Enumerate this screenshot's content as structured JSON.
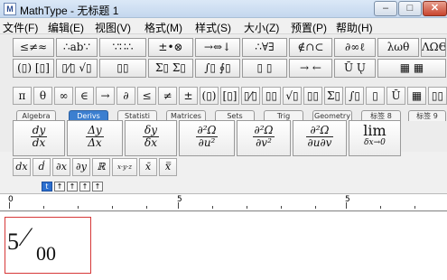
{
  "window": {
    "title": "MathType - 无标题 1",
    "app_icon": "mathtype-icon",
    "min": "–",
    "max": "□",
    "close": "✕"
  },
  "menu": [
    "文件(F)",
    "编辑(E)",
    "视图(V)",
    "格式(M)",
    "样式(S)",
    "大小(Z)",
    "预置(P)",
    "帮助(H)"
  ],
  "toolbar_row1": [
    "≤≠≈",
    "∴ab∵",
    "∵∷∴",
    "±•⊗",
    "→⇔↓",
    "∴∀∃",
    "∉∩⊂",
    "∂∞ℓ",
    "λωθ",
    "ΛΩΘ"
  ],
  "toolbar_row2": [
    "(▯) [▯]",
    "▯⁄▯ √▯",
    "▯▯",
    "Σ▯ Σ▯",
    "∫▯ ∮▯",
    "▯ ▯",
    "→ ←",
    "Ū Ų",
    "▦ ▦"
  ],
  "toolbar_row3": [
    "π",
    "θ",
    "∞",
    "∈",
    "→",
    "∂",
    "≤",
    "≠",
    "±",
    "(▯)",
    "[▯]",
    "▯⁄▯",
    "▯▯",
    "√▯",
    "▯▯",
    "Σ▯",
    "∫▯",
    "▯",
    "Ū",
    "▦",
    "▯▯",
    "▯▯",
    "▯▯"
  ],
  "tabs": [
    "Algebra",
    "Derivs",
    "Statisti",
    "Matrices",
    "Sets",
    "Trig",
    "Geometry",
    "标签 8",
    "标签 9"
  ],
  "active_tab": "Derivs",
  "deriv_templates": [
    {
      "num": "dy",
      "den": "dx"
    },
    {
      "num": "Δy",
      "den": "Δx"
    },
    {
      "num": "δy",
      "den": "δx"
    },
    {
      "num": "∂²Ω",
      "den": "∂u²"
    },
    {
      "num": "∂²Ω",
      "den": "∂v²"
    },
    {
      "num": "∂²Ω",
      "den": "∂u∂v"
    }
  ],
  "lim_template": {
    "top": "lim",
    "bottom": "δx→0"
  },
  "small_templates": [
    "dx",
    "ḋ",
    "∂x",
    "∂y",
    "ℝ",
    "x·y·z",
    "x̄",
    "x̿"
  ],
  "size_buttons": [
    "t",
    "↑",
    "↑",
    "↑",
    "↑"
  ],
  "ruler": {
    "marks": [
      "0",
      "5",
      "5"
    ]
  },
  "equation": {
    "whole": "5",
    "slash": "⁄",
    "den": "00"
  }
}
